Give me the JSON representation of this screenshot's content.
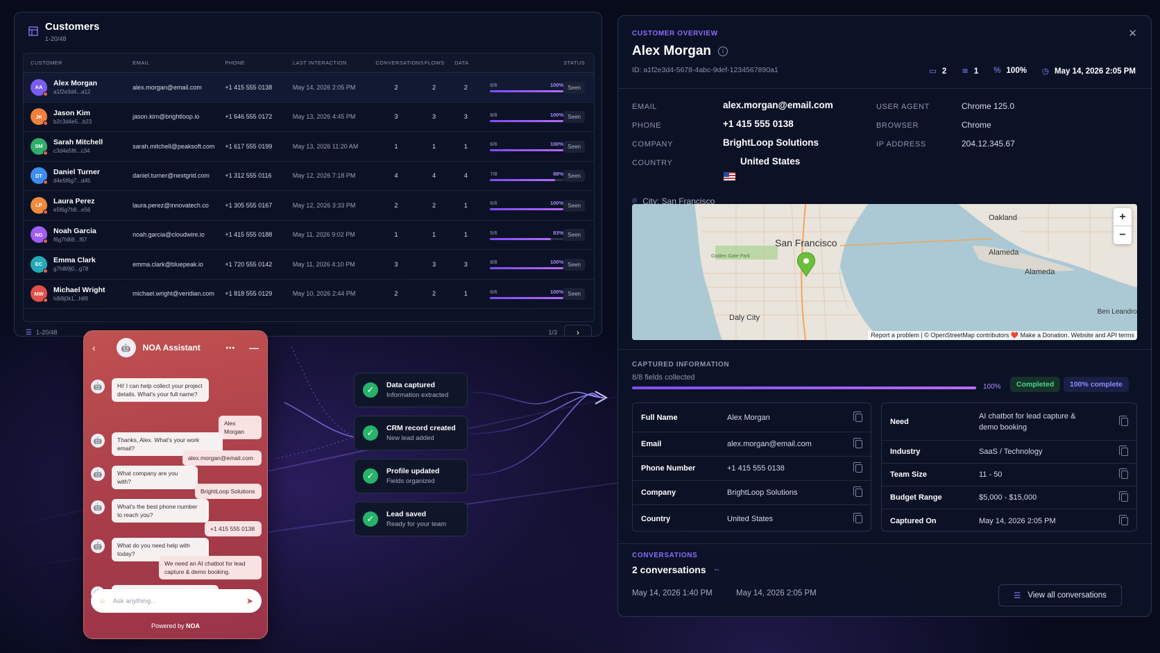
{
  "customers": {
    "title": "Customers",
    "subtitle": "1-20/48",
    "columns": [
      "CUSTOMER",
      "EMAIL",
      "PHONE",
      "LAST INTERACTION",
      "CONVERSATIONS",
      "FLOWS",
      "DATA",
      "STATUS"
    ],
    "rows": [
      {
        "initials": "AA",
        "color": "#7b5cf0",
        "name": "Alex Morgan",
        "id": "a1f2e3d4...a12",
        "email": "alex.morgan@email.com",
        "phone": "+1 415 555 0138",
        "last": "May 14, 2026 2:05 PM",
        "conv": "2",
        "flows": "2",
        "data_label": "6/6",
        "data_pct_label": "100%",
        "data_pct": 100,
        "status": "Seen",
        "selected": true
      },
      {
        "initials": "JK",
        "color": "#f0803c",
        "name": "Jason Kim",
        "id": "b2c3d4e5...b23",
        "email": "jason.kim@brightloop.io",
        "phone": "+1 646 555 0172",
        "last": "May 13, 2026 4:45 PM",
        "conv": "3",
        "flows": "3",
        "data_label": "8/8",
        "data_pct_label": "100%",
        "data_pct": 100,
        "status": "Seen"
      },
      {
        "initials": "SM",
        "color": "#2fae6b",
        "name": "Sarah Mitchell",
        "id": "c3d4e5f6...c34",
        "email": "sarah.mitchell@peaksoft.com",
        "phone": "+1 617 555 0199",
        "last": "May 13, 2026 11:20 AM",
        "conv": "1",
        "flows": "1",
        "data_label": "6/6",
        "data_pct_label": "100%",
        "data_pct": 100,
        "status": "Seen"
      },
      {
        "initials": "DT",
        "color": "#3d8ef0",
        "name": "Daniel Turner",
        "id": "d4e5f6g7...d45",
        "email": "daniel.turner@nextgrid.com",
        "phone": "+1 312 555 0116",
        "last": "May 12, 2026 7:18 PM",
        "conv": "4",
        "flows": "4",
        "data_label": "7/8",
        "data_pct_label": "88%",
        "data_pct": 88,
        "status": "Seen"
      },
      {
        "initials": "LP",
        "color": "#f08a3c",
        "name": "Laura Perez",
        "id": "e5f6g7h8...e56",
        "email": "laura.perez@innovatech.co",
        "phone": "+1 305 555 0167",
        "last": "May 12, 2026 3:33 PM",
        "conv": "2",
        "flows": "1",
        "data_label": "6/6",
        "data_pct_label": "100%",
        "data_pct": 100,
        "status": "Seen"
      },
      {
        "initials": "NG",
        "color": "#a15cf0",
        "name": "Noah Garcia",
        "id": "f6g7h8i9...f67",
        "email": "noah.garcia@cloudwire.io",
        "phone": "+1 415 555 0188",
        "last": "May 11, 2026 9:02 PM",
        "conv": "1",
        "flows": "1",
        "data_label": "5/6",
        "data_pct_label": "83%",
        "data_pct": 83,
        "status": "Seen"
      },
      {
        "initials": "EC",
        "color": "#23a9b8",
        "name": "Emma Clark",
        "id": "g7h8i9j0...g78",
        "email": "emma.clark@bluepeak.io",
        "phone": "+1 720 555 0142",
        "last": "May 11, 2026 4:10 PM",
        "conv": "3",
        "flows": "3",
        "data_label": "8/8",
        "data_pct_label": "100%",
        "data_pct": 100,
        "status": "Seen"
      },
      {
        "initials": "MW",
        "color": "#e4504a",
        "name": "Michael Wright",
        "id": "h8i9j0k1...h89",
        "email": "michael.wright@veridian.com",
        "phone": "+1 818 555 0129",
        "last": "May 10, 2026 2:44 PM",
        "conv": "2",
        "flows": "1",
        "data_label": "6/6",
        "data_pct_label": "100%",
        "data_pct": 100,
        "status": "Seen"
      }
    ],
    "footer_range": "1-20/48",
    "page": "1/3"
  },
  "chat": {
    "title": "NOA Assistant",
    "messages": [
      {
        "from": "bot",
        "text": "Hi! I can help collect your project details. What's your full name?"
      },
      {
        "from": "user",
        "text": "Alex Morgan"
      },
      {
        "from": "bot",
        "text": "Thanks, Alex. What's your work email?"
      },
      {
        "from": "user",
        "text": "alex.morgan@email.com"
      },
      {
        "from": "bot",
        "text": "What company are you with?"
      },
      {
        "from": "user",
        "text": "BrightLoop Solutions"
      },
      {
        "from": "bot",
        "text": "What's the best phone number to reach you?"
      },
      {
        "from": "user",
        "text": "+1 415 555 0138"
      },
      {
        "from": "bot",
        "text": "What do you need help with today?"
      },
      {
        "from": "user",
        "text": "We need an AI chatbot for lead capture & demo booking."
      },
      {
        "from": "bot",
        "text": "Perfect — I've captured your details."
      }
    ],
    "input_placeholder": "Ask anything...",
    "powered_prefix": "Powered by",
    "powered_brand": "NOA"
  },
  "steps": [
    {
      "title": "Data captured",
      "sub": "Information extracted"
    },
    {
      "title": "CRM record created",
      "sub": "New lead added"
    },
    {
      "title": "Profile updated",
      "sub": "Fields organized"
    },
    {
      "title": "Lead saved",
      "sub": "Ready for your team"
    }
  ],
  "detail": {
    "overline": "CUSTOMER OVERVIEW",
    "name": "Alex Morgan",
    "id": "ID: a1f2e3d4-5678-4abc-9def-1234567890a1",
    "stats": {
      "conversations": "2",
      "flows": "1",
      "completion": "100%",
      "date": "May 14, 2026 2:05 PM"
    },
    "info_left": [
      {
        "k": "EMAIL",
        "v": "alex.morgan@email.com"
      },
      {
        "k": "PHONE",
        "v": "+1 415 555 0138"
      },
      {
        "k": "COMPANY",
        "v": "BrightLoop Solutions"
      },
      {
        "k": "COUNTRY",
        "v": "United States"
      }
    ],
    "info_right": [
      {
        "k": "USER AGENT",
        "v": "Chrome 125.0"
      },
      {
        "k": "BROWSER",
        "v": "Chrome"
      },
      {
        "k": "IP ADDRESS",
        "v": "204.12.345.67"
      }
    ],
    "city": "City: San Francisco",
    "map": {
      "labels": [
        "San Francisco",
        "Oakland",
        "Alameda",
        "Alameda",
        "Daly City",
        "Golden Gate Park",
        "Ben Leandro"
      ],
      "attribution": "Report a problem | © OpenStreetMap contributors ❤️ Make a Donation. Website and API terms"
    },
    "captured": {
      "title": "CAPTURED INFORMATION",
      "sub": "8/8 fields collected",
      "pct_label": "100%",
      "pct": 100,
      "status": "Completed",
      "complete": "100% complete"
    },
    "fields_left": [
      {
        "k": "Full Name",
        "v": "Alex Morgan"
      },
      {
        "k": "Email",
        "v": "alex.morgan@email.com"
      },
      {
        "k": "Phone Number",
        "v": "+1 415 555 0138"
      },
      {
        "k": "Company",
        "v": "BrightLoop Solutions"
      },
      {
        "k": "Country",
        "v": "United States"
      }
    ],
    "fields_right": [
      {
        "k": "Need",
        "v": "AI chatbot for lead capture & demo booking"
      },
      {
        "k": "Industry",
        "v": "SaaS / Technology"
      },
      {
        "k": "Team Size",
        "v": "11 - 50"
      },
      {
        "k": "Budget Range",
        "v": "$5,000 - $15,000"
      },
      {
        "k": "Captured On",
        "v": "May 14, 2026 2:05 PM"
      }
    ],
    "conversations": {
      "title": "CONVERSATIONS",
      "count": "2 conversations",
      "dates": [
        "May 14, 2026 1:40 PM",
        "May 14, 2026 2:05 PM"
      ],
      "view_all": "View all conversations"
    }
  },
  "colors": {
    "accent": "#8a6cff",
    "success": "#27b36a",
    "chat": "#b4444c"
  }
}
